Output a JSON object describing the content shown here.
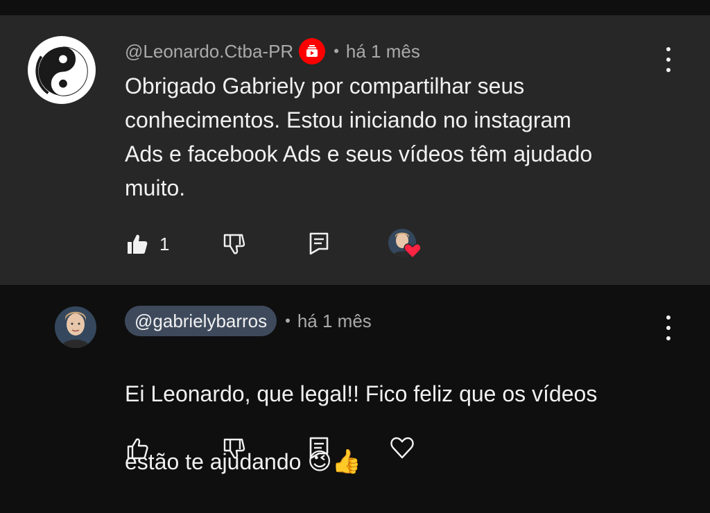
{
  "comments": [
    {
      "author": "@Leonardo.Ctba-PR",
      "time": "há 1 mês",
      "separator": "•",
      "text": "Obrigado Gabriely por compartilhar seus\nconhecimentos. Estou iniciando no instagram\nAds e facebook Ads e seus vídeos têm ajudado\nmuito.",
      "likes": "1",
      "avatar_icon": "yin-yang-icon",
      "badge_icon": "member-badge-icon"
    },
    {
      "author": "@gabrielybarros",
      "time": "há 1 mês",
      "separator": "•",
      "text_line1": "Ei Leonardo, que legal!! Fico feliz que os vídeos",
      "text_line2": "estão te ajudando ",
      "emoji1": "😉",
      "emoji2": "👍"
    }
  ],
  "colors": {
    "main_bg": "#272727",
    "reply_bg": "#0f0f0f",
    "chip_bg": "#3e4a5c",
    "heart": "#ff2442",
    "badge": "#ff0000"
  }
}
